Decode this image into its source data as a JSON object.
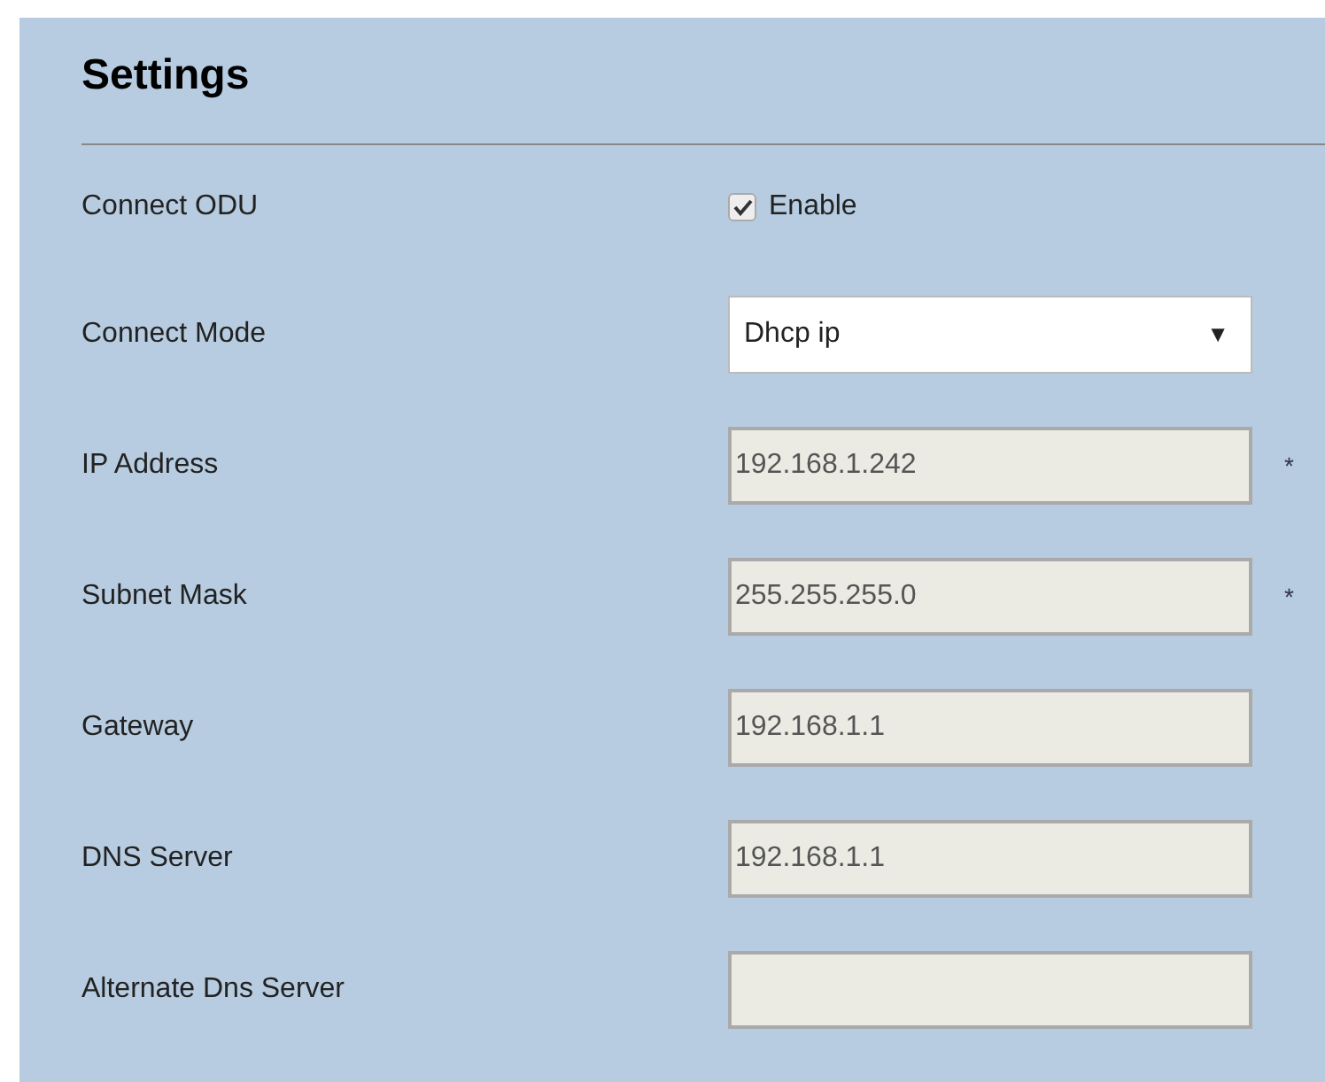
{
  "title": "Settings",
  "rows": [
    {
      "kind": "checkbox",
      "label": "Connect ODU",
      "checked": true,
      "option": "Enable"
    },
    {
      "kind": "select",
      "label": "Connect Mode",
      "value": "Dhcp ip",
      "arrow": "▼"
    },
    {
      "kind": "text",
      "label": "IP Address",
      "value": "192.168.1.242",
      "disabled": true,
      "mark": "*"
    },
    {
      "kind": "text",
      "label": "Subnet Mask",
      "value": "255.255.255.0",
      "disabled": true,
      "mark": "*"
    },
    {
      "kind": "text",
      "label": "Gateway",
      "value": "192.168.1.1",
      "disabled": true
    },
    {
      "kind": "text",
      "label": "DNS Server",
      "value": "192.168.1.1",
      "disabled": true
    },
    {
      "kind": "text",
      "label": "Alternate Dns Server",
      "disabled": true
    }
  ]
}
